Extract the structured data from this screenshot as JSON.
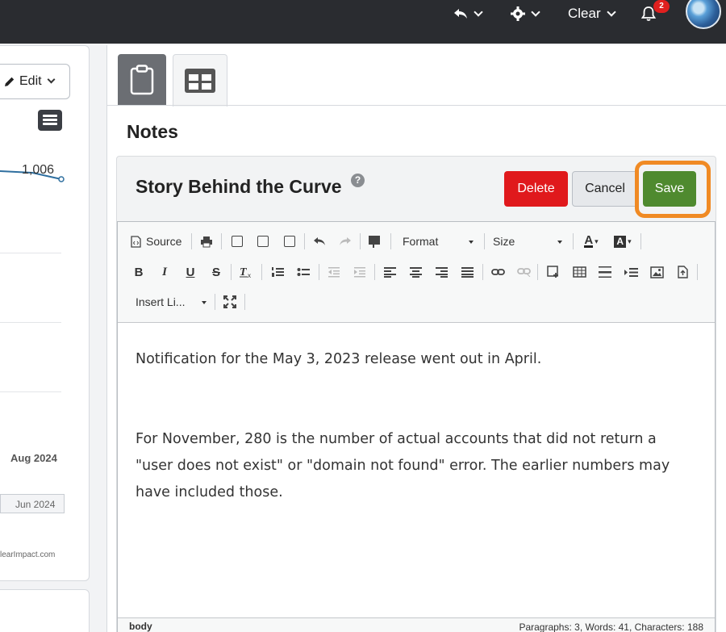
{
  "topbar": {
    "undo_icon": "undo-arrow-icon",
    "settings_icon": "gear-icon",
    "workspace_label": "Clear",
    "notification_count": "2",
    "notification_icon": "bell-icon"
  },
  "left_panel": {
    "edit_label": "Edit",
    "chart_value": "1,006",
    "axis_label": "Aug 2024",
    "scroll_label": "Jun 2024",
    "credit": "learImpact.com"
  },
  "tabs": [
    {
      "icon": "clipboard-icon",
      "active": true
    },
    {
      "icon": "table-grid-icon",
      "active": false
    }
  ],
  "notes": {
    "section_title": "Notes",
    "story_title": "Story Behind the Curve",
    "help_icon": "?",
    "buttons": {
      "delete": "Delete",
      "cancel": "Cancel",
      "save": "Save"
    }
  },
  "editor": {
    "toolbar": {
      "source": "Source",
      "format": "Format",
      "size": "Size",
      "insert": "Insert Li...",
      "bold": "B",
      "italic": "I",
      "underline": "U",
      "strike": "S"
    },
    "paragraphs": [
      "Notification for the May 3, 2023 release went out in April.",
      "",
      "For November, 280 is the number of actual accounts that did not return a \"user does not exist\" or \"domain not found\" error. The earlier numbers may have included those."
    ],
    "status_path": "body",
    "status_counts": "Paragraphs: 3, Words: 41, Characters: 188"
  },
  "colors": {
    "topbar": "#2a2c30",
    "delete": "#e0191c",
    "save": "#4f8a2f",
    "highlight": "#f08a24"
  }
}
